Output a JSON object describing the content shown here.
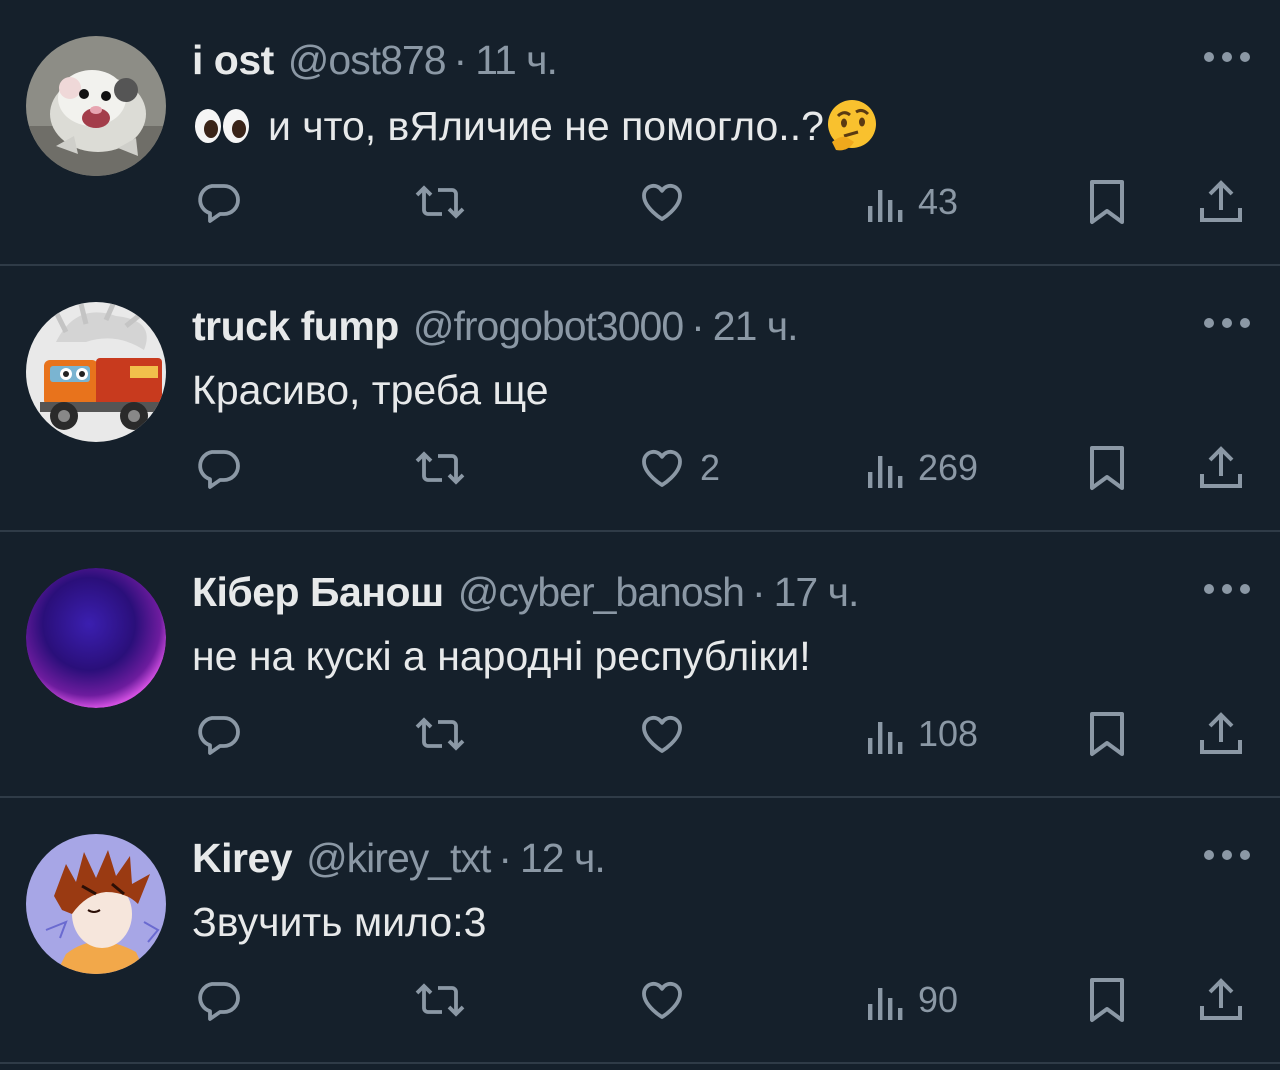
{
  "tweets": [
    {
      "name": "i ost",
      "handle": "@ost878",
      "separator": "·",
      "time": "11 ч.",
      "text": "и что, вЯличие не помогло..?",
      "leading_emoji": "eyes-emoji",
      "trailing_emoji": "thinking-face-emoji",
      "replies": "",
      "retweets": "",
      "likes": "",
      "views": "43",
      "avatar": "opossum-avatar"
    },
    {
      "name": "truck fump",
      "handle": "@frogobot3000",
      "separator": "·",
      "time": "21 ч.",
      "text": "Красиво, треба ще",
      "replies": "",
      "retweets": "",
      "likes": "2",
      "views": "269",
      "avatar": "cartoon-truck-avatar"
    },
    {
      "name": "Кібер Банош",
      "handle": "@cyber_banosh",
      "separator": "·",
      "time": "17 ч.",
      "text": "не на кускі а народні республіки!",
      "replies": "",
      "retweets": "",
      "likes": "",
      "views": "108",
      "avatar": "purple-orb-avatar"
    },
    {
      "name": "Kirey",
      "handle": "@kirey_txt",
      "separator": "·",
      "time": "12 ч.",
      "text": "Звучить мило:3",
      "replies": "",
      "retweets": "",
      "likes": "",
      "views": "90",
      "avatar": "drawn-character-avatar"
    }
  ],
  "colors": {
    "background": "#15202b",
    "divider": "#2f3b47",
    "primary_text": "#e7e9ea",
    "secondary_text": "#8b98a5"
  }
}
